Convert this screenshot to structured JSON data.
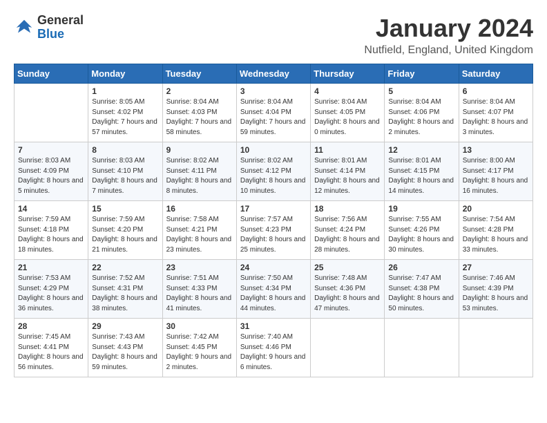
{
  "header": {
    "logo_text_general": "General",
    "logo_text_blue": "Blue",
    "month_title": "January 2024",
    "location": "Nutfield, England, United Kingdom"
  },
  "days_of_week": [
    "Sunday",
    "Monday",
    "Tuesday",
    "Wednesday",
    "Thursday",
    "Friday",
    "Saturday"
  ],
  "weeks": [
    [
      {
        "day": "",
        "sunrise": "",
        "sunset": "",
        "daylight": ""
      },
      {
        "day": "1",
        "sunrise": "Sunrise: 8:05 AM",
        "sunset": "Sunset: 4:02 PM",
        "daylight": "Daylight: 7 hours and 57 minutes."
      },
      {
        "day": "2",
        "sunrise": "Sunrise: 8:04 AM",
        "sunset": "Sunset: 4:03 PM",
        "daylight": "Daylight: 7 hours and 58 minutes."
      },
      {
        "day": "3",
        "sunrise": "Sunrise: 8:04 AM",
        "sunset": "Sunset: 4:04 PM",
        "daylight": "Daylight: 7 hours and 59 minutes."
      },
      {
        "day": "4",
        "sunrise": "Sunrise: 8:04 AM",
        "sunset": "Sunset: 4:05 PM",
        "daylight": "Daylight: 8 hours and 0 minutes."
      },
      {
        "day": "5",
        "sunrise": "Sunrise: 8:04 AM",
        "sunset": "Sunset: 4:06 PM",
        "daylight": "Daylight: 8 hours and 2 minutes."
      },
      {
        "day": "6",
        "sunrise": "Sunrise: 8:04 AM",
        "sunset": "Sunset: 4:07 PM",
        "daylight": "Daylight: 8 hours and 3 minutes."
      }
    ],
    [
      {
        "day": "7",
        "sunrise": "Sunrise: 8:03 AM",
        "sunset": "Sunset: 4:09 PM",
        "daylight": "Daylight: 8 hours and 5 minutes."
      },
      {
        "day": "8",
        "sunrise": "Sunrise: 8:03 AM",
        "sunset": "Sunset: 4:10 PM",
        "daylight": "Daylight: 8 hours and 7 minutes."
      },
      {
        "day": "9",
        "sunrise": "Sunrise: 8:02 AM",
        "sunset": "Sunset: 4:11 PM",
        "daylight": "Daylight: 8 hours and 8 minutes."
      },
      {
        "day": "10",
        "sunrise": "Sunrise: 8:02 AM",
        "sunset": "Sunset: 4:12 PM",
        "daylight": "Daylight: 8 hours and 10 minutes."
      },
      {
        "day": "11",
        "sunrise": "Sunrise: 8:01 AM",
        "sunset": "Sunset: 4:14 PM",
        "daylight": "Daylight: 8 hours and 12 minutes."
      },
      {
        "day": "12",
        "sunrise": "Sunrise: 8:01 AM",
        "sunset": "Sunset: 4:15 PM",
        "daylight": "Daylight: 8 hours and 14 minutes."
      },
      {
        "day": "13",
        "sunrise": "Sunrise: 8:00 AM",
        "sunset": "Sunset: 4:17 PM",
        "daylight": "Daylight: 8 hours and 16 minutes."
      }
    ],
    [
      {
        "day": "14",
        "sunrise": "Sunrise: 7:59 AM",
        "sunset": "Sunset: 4:18 PM",
        "daylight": "Daylight: 8 hours and 18 minutes."
      },
      {
        "day": "15",
        "sunrise": "Sunrise: 7:59 AM",
        "sunset": "Sunset: 4:20 PM",
        "daylight": "Daylight: 8 hours and 21 minutes."
      },
      {
        "day": "16",
        "sunrise": "Sunrise: 7:58 AM",
        "sunset": "Sunset: 4:21 PM",
        "daylight": "Daylight: 8 hours and 23 minutes."
      },
      {
        "day": "17",
        "sunrise": "Sunrise: 7:57 AM",
        "sunset": "Sunset: 4:23 PM",
        "daylight": "Daylight: 8 hours and 25 minutes."
      },
      {
        "day": "18",
        "sunrise": "Sunrise: 7:56 AM",
        "sunset": "Sunset: 4:24 PM",
        "daylight": "Daylight: 8 hours and 28 minutes."
      },
      {
        "day": "19",
        "sunrise": "Sunrise: 7:55 AM",
        "sunset": "Sunset: 4:26 PM",
        "daylight": "Daylight: 8 hours and 30 minutes."
      },
      {
        "day": "20",
        "sunrise": "Sunrise: 7:54 AM",
        "sunset": "Sunset: 4:28 PM",
        "daylight": "Daylight: 8 hours and 33 minutes."
      }
    ],
    [
      {
        "day": "21",
        "sunrise": "Sunrise: 7:53 AM",
        "sunset": "Sunset: 4:29 PM",
        "daylight": "Daylight: 8 hours and 36 minutes."
      },
      {
        "day": "22",
        "sunrise": "Sunrise: 7:52 AM",
        "sunset": "Sunset: 4:31 PM",
        "daylight": "Daylight: 8 hours and 38 minutes."
      },
      {
        "day": "23",
        "sunrise": "Sunrise: 7:51 AM",
        "sunset": "Sunset: 4:33 PM",
        "daylight": "Daylight: 8 hours and 41 minutes."
      },
      {
        "day": "24",
        "sunrise": "Sunrise: 7:50 AM",
        "sunset": "Sunset: 4:34 PM",
        "daylight": "Daylight: 8 hours and 44 minutes."
      },
      {
        "day": "25",
        "sunrise": "Sunrise: 7:48 AM",
        "sunset": "Sunset: 4:36 PM",
        "daylight": "Daylight: 8 hours and 47 minutes."
      },
      {
        "day": "26",
        "sunrise": "Sunrise: 7:47 AM",
        "sunset": "Sunset: 4:38 PM",
        "daylight": "Daylight: 8 hours and 50 minutes."
      },
      {
        "day": "27",
        "sunrise": "Sunrise: 7:46 AM",
        "sunset": "Sunset: 4:39 PM",
        "daylight": "Daylight: 8 hours and 53 minutes."
      }
    ],
    [
      {
        "day": "28",
        "sunrise": "Sunrise: 7:45 AM",
        "sunset": "Sunset: 4:41 PM",
        "daylight": "Daylight: 8 hours and 56 minutes."
      },
      {
        "day": "29",
        "sunrise": "Sunrise: 7:43 AM",
        "sunset": "Sunset: 4:43 PM",
        "daylight": "Daylight: 8 hours and 59 minutes."
      },
      {
        "day": "30",
        "sunrise": "Sunrise: 7:42 AM",
        "sunset": "Sunset: 4:45 PM",
        "daylight": "Daylight: 9 hours and 2 minutes."
      },
      {
        "day": "31",
        "sunrise": "Sunrise: 7:40 AM",
        "sunset": "Sunset: 4:46 PM",
        "daylight": "Daylight: 9 hours and 6 minutes."
      },
      {
        "day": "",
        "sunrise": "",
        "sunset": "",
        "daylight": ""
      },
      {
        "day": "",
        "sunrise": "",
        "sunset": "",
        "daylight": ""
      },
      {
        "day": "",
        "sunrise": "",
        "sunset": "",
        "daylight": ""
      }
    ]
  ]
}
